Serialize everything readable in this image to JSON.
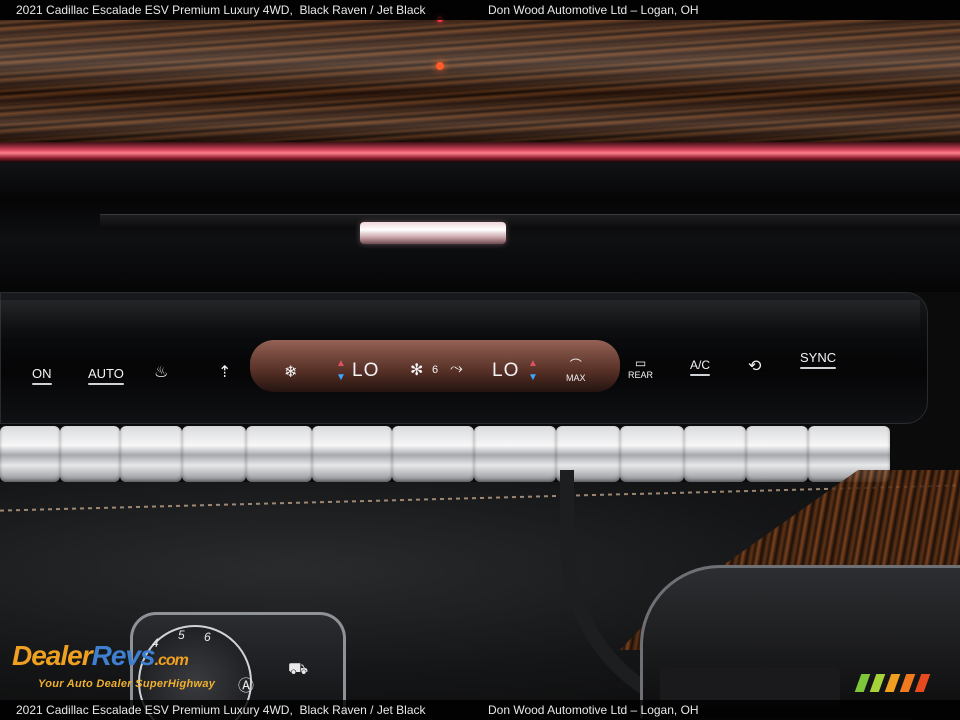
{
  "caption": {
    "vehicle": "2021 Cadillac Escalade ESV Premium Luxury 4WD,",
    "colors": "Black Raven / Jet Black",
    "dealer": "Don Wood Automotive Ltd – Logan, OH"
  },
  "climate_controls": {
    "on": "ON",
    "auto": "AUTO",
    "temp_left": "LO",
    "fan_level": "6",
    "temp_right": "LO",
    "max": "MAX",
    "rear": "REAR",
    "ac": "A/C",
    "sync": "SYNC"
  },
  "gauge": {
    "numbers": [
      "4",
      "5",
      "6"
    ]
  },
  "watermark": {
    "logo_part1": "Dealer",
    "logo_part2": "Revs",
    "logo_suffix": ".com",
    "tagline": "Your Auto Dealer SuperHighway"
  },
  "stripe_colors": [
    "#7ec63a",
    "#a6d23a",
    "#f0a020",
    "#f07a20",
    "#e84a20"
  ]
}
